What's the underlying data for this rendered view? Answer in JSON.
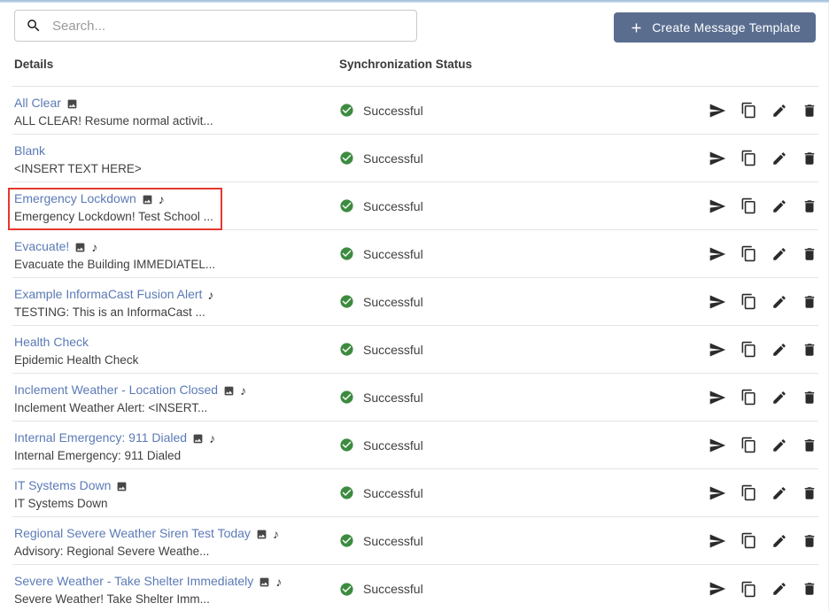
{
  "toolbar": {
    "search": {
      "placeholder": "Search..."
    },
    "create_button": {
      "label": "Create Message Template",
      "icon": "plus-icon"
    }
  },
  "table": {
    "headers": {
      "details": "Details",
      "status": "Synchronization Status"
    },
    "row_actions": [
      "send",
      "duplicate",
      "edit",
      "delete"
    ],
    "rows": [
      {
        "name": "All Clear",
        "description": "ALL CLEAR! Resume normal activit...",
        "has_image": true,
        "has_audio": false,
        "status": "Successful",
        "highlighted": false
      },
      {
        "name": "Blank",
        "description": "<INSERT TEXT HERE>",
        "has_image": false,
        "has_audio": false,
        "status": "Successful",
        "highlighted": false
      },
      {
        "name": "Emergency Lockdown",
        "description": "Emergency Lockdown! Test School ...",
        "has_image": true,
        "has_audio": true,
        "status": "Successful",
        "highlighted": true
      },
      {
        "name": "Evacuate!",
        "description": "Evacuate the Building IMMEDIATEL...",
        "has_image": true,
        "has_audio": true,
        "status": "Successful",
        "highlighted": false
      },
      {
        "name": "Example InformaCast Fusion Alert",
        "description": "TESTING: This is an InformaCast ...",
        "has_image": false,
        "has_audio": true,
        "status": "Successful",
        "highlighted": false
      },
      {
        "name": "Health Check",
        "description": "Epidemic Health Check",
        "has_image": false,
        "has_audio": false,
        "status": "Successful",
        "highlighted": false
      },
      {
        "name": "Inclement Weather - Location Closed",
        "description": "Inclement Weather Alert: <INSERT...",
        "has_image": true,
        "has_audio": true,
        "status": "Successful",
        "highlighted": false
      },
      {
        "name": "Internal Emergency: 911 Dialed",
        "description": "Internal Emergency: 911 Dialed",
        "has_image": true,
        "has_audio": true,
        "status": "Successful",
        "highlighted": false
      },
      {
        "name": "IT Systems Down",
        "description": "IT Systems Down",
        "has_image": true,
        "has_audio": false,
        "status": "Successful",
        "highlighted": false
      },
      {
        "name": "Regional Severe Weather Siren Test Today",
        "description": "Advisory: Regional Severe Weathe...",
        "has_image": true,
        "has_audio": true,
        "status": "Successful",
        "highlighted": false
      },
      {
        "name": "Severe Weather - Take Shelter Immediately",
        "description": "Severe Weather! Take Shelter Imm...",
        "has_image": true,
        "has_audio": true,
        "status": "Successful",
        "highlighted": false
      }
    ]
  },
  "icons": {
    "search": "magnifier",
    "create": "plus",
    "image_attachment": "photo-square",
    "audio_attachment": "music-note",
    "audio_glyph": "♪",
    "status_ok": "check-circle",
    "send": "paper-plane",
    "duplicate": "copy-pages",
    "edit": "pencil",
    "delete": "trash"
  },
  "colors": {
    "button_bg": "#5a6d8f",
    "link": "#5b7ab6",
    "success_green": "#3d8b40",
    "highlight_border": "#e5382e",
    "divider": "#e4e4e4",
    "top_strip": "#9dbcd6"
  }
}
